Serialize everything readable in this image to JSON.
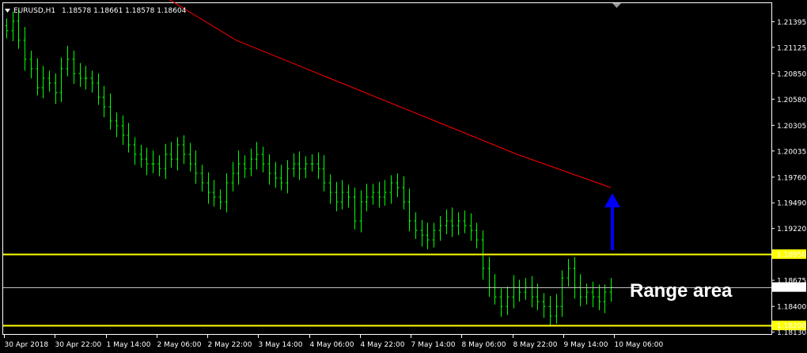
{
  "header": {
    "symbol": "EURUSD,H1",
    "ohlc": "1.18578 1.18661 1.18578 1.18604"
  },
  "colors": {
    "background": "#000000",
    "candles": "#00ff00",
    "moving_average": "#ff0000",
    "level_lines": "#ffff00",
    "current_price": "#c0c0c0",
    "arrow": "#0000ff",
    "axis_text": "#ffffff"
  },
  "annotation": {
    "text": "Range area"
  },
  "chart_data": {
    "type": "bar",
    "title": "",
    "xlabel": "",
    "ylabel": "",
    "ylim": [
      1.1811,
      1.2159
    ],
    "y_ticks": [
      "1.21395",
      "1.21125",
      "1.20850",
      "1.20580",
      "1.20305",
      "1.20035",
      "1.19760",
      "1.19490",
      "1.19220",
      "1.18950",
      "1.18675",
      "1.18604",
      "1.18400",
      "1.18200",
      "1.18130"
    ],
    "x_ticks": [
      "30 Apr 2018",
      "30 Apr 22:00",
      "1 May 14:00",
      "2 May 06:00",
      "2 May 22:00",
      "3 May 14:00",
      "4 May 06:00",
      "4 May 22:00",
      "7 May 14:00",
      "8 May 06:00",
      "8 May 22:00",
      "9 May 14:00",
      "10 May 06:00"
    ],
    "series": [
      {
        "type": "ohlc_bars",
        "close": [
          1.213,
          1.214,
          1.212,
          1.21,
          1.209,
          1.207,
          1.208,
          1.2075,
          1.2065,
          1.209,
          1.21,
          1.2085,
          1.208,
          1.208,
          1.2075,
          1.206,
          1.205,
          1.2035,
          1.203,
          1.202,
          1.201,
          1.2,
          1.1995,
          1.199,
          1.199,
          1.1985,
          1.2,
          1.1995,
          1.201,
          1.2,
          1.199,
          1.198,
          1.197,
          1.196,
          1.1955,
          1.195,
          1.197,
          1.198,
          1.199,
          1.1985,
          1.1995,
          1.2,
          1.199,
          1.198,
          1.1975,
          1.197,
          1.1985,
          1.199,
          1.1985,
          1.199,
          1.199,
          1.1985,
          1.197,
          1.196,
          1.195,
          1.196,
          1.1955,
          1.193,
          1.195,
          1.1955,
          1.196,
          1.1955,
          1.196,
          1.197,
          1.1965,
          1.195,
          1.193,
          1.192,
          1.1915,
          1.191,
          1.192,
          1.1925,
          1.193,
          1.1925,
          1.193,
          1.1925,
          1.192,
          1.191,
          1.188,
          1.186,
          1.185,
          1.184,
          1.185,
          1.186,
          1.1855,
          1.186,
          1.185,
          1.1845,
          1.184,
          1.183,
          1.184,
          1.187,
          1.188,
          1.186,
          1.185,
          1.1855,
          1.185,
          1.1845,
          1.1855,
          1.186
        ]
      },
      {
        "name": "",
        "type": "line",
        "values": [
          1.218,
          1.212,
          1.208,
          1.204,
          1.2,
          1.1965
        ]
      }
    ],
    "levels": [
      {
        "label": "1.18950",
        "value": 1.1895
      },
      {
        "label": "1.18200",
        "value": 1.182
      }
    ],
    "current_price": "1.18604",
    "grid": false
  }
}
